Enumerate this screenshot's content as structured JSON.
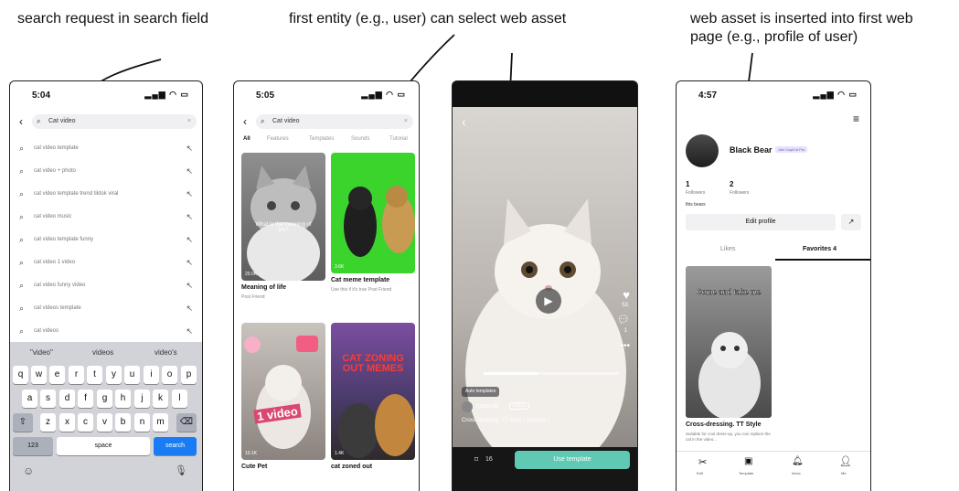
{
  "captions": {
    "left": "search request in search field",
    "middle": "first entity (e.g., user) can select web asset",
    "right_line1": "web asset is inserted into first web",
    "right_line2": "page (e.g., profile of user)"
  },
  "phone1": {
    "time": "5:04",
    "search_value": "Cat video",
    "suggestions": [
      "cat video template",
      "cat video + photo",
      "cat video template trend tiktok viral",
      "cat video music",
      "cat video template funny",
      "cat video 1 video",
      "cat video funny video",
      "cat videos template",
      "cat videos"
    ],
    "predictions": [
      "\"video\"",
      "videos",
      "video's"
    ],
    "keys_row1": [
      "q",
      "w",
      "e",
      "r",
      "t",
      "y",
      "u",
      "i",
      "o",
      "p"
    ],
    "keys_row2": [
      "a",
      "s",
      "d",
      "f",
      "g",
      "h",
      "j",
      "k",
      "l"
    ],
    "keys_row3": [
      "z",
      "x",
      "c",
      "v",
      "b",
      "n",
      "m"
    ],
    "key_123": "123",
    "key_space": "space",
    "key_search": "search"
  },
  "phone2": {
    "time": "5:05",
    "search_value": "Cat video",
    "tabs": [
      "All",
      "Features",
      "Templates",
      "Sounds",
      "Tutorial"
    ],
    "cards": [
      {
        "title": "Meaning of life",
        "sub": "Post Friend",
        "count": "20.0K",
        "overlay": "What is the meaning of life?"
      },
      {
        "title": "Cat meme template",
        "sub": "Use this if it's true Post Friend",
        "count": "3.6K",
        "overlay": ""
      },
      {
        "title": "Cute Pet",
        "sub": "",
        "count": "10.1K",
        "overlay": "1 video"
      },
      {
        "title": "cat zoned out",
        "sub": "",
        "count": "1.4K",
        "overlay": "CAT ZONING OUT MEMES"
      }
    ]
  },
  "phone3": {
    "like_count": "53",
    "comment_count": "1",
    "auto_templates": "Auto templates",
    "username": "cooocib",
    "follow": "Follow",
    "caption": "Cross-dressing. TT Style | Suitable f...",
    "save_count": "16",
    "use_template": "Use template"
  },
  "phone4": {
    "time": "4:57",
    "name": "Black Bear",
    "pro_badge": "Join CapCut Pro",
    "followers_count": "1",
    "followers_label": "Followers",
    "following_count": "2",
    "following_label": "Followers",
    "bio": "this bears",
    "edit_profile": "Edit profile",
    "tab_likes": "Likes",
    "tab_favorites": "Favorites 4",
    "post_overlay": "Come and take me",
    "post_title": "Cross-dressing. TT Style",
    "post_sub": "Suitable for cool dress-up, you can replace the cat in the video...",
    "nav": [
      "Edit",
      "Template",
      "Inbox",
      "Me"
    ]
  }
}
